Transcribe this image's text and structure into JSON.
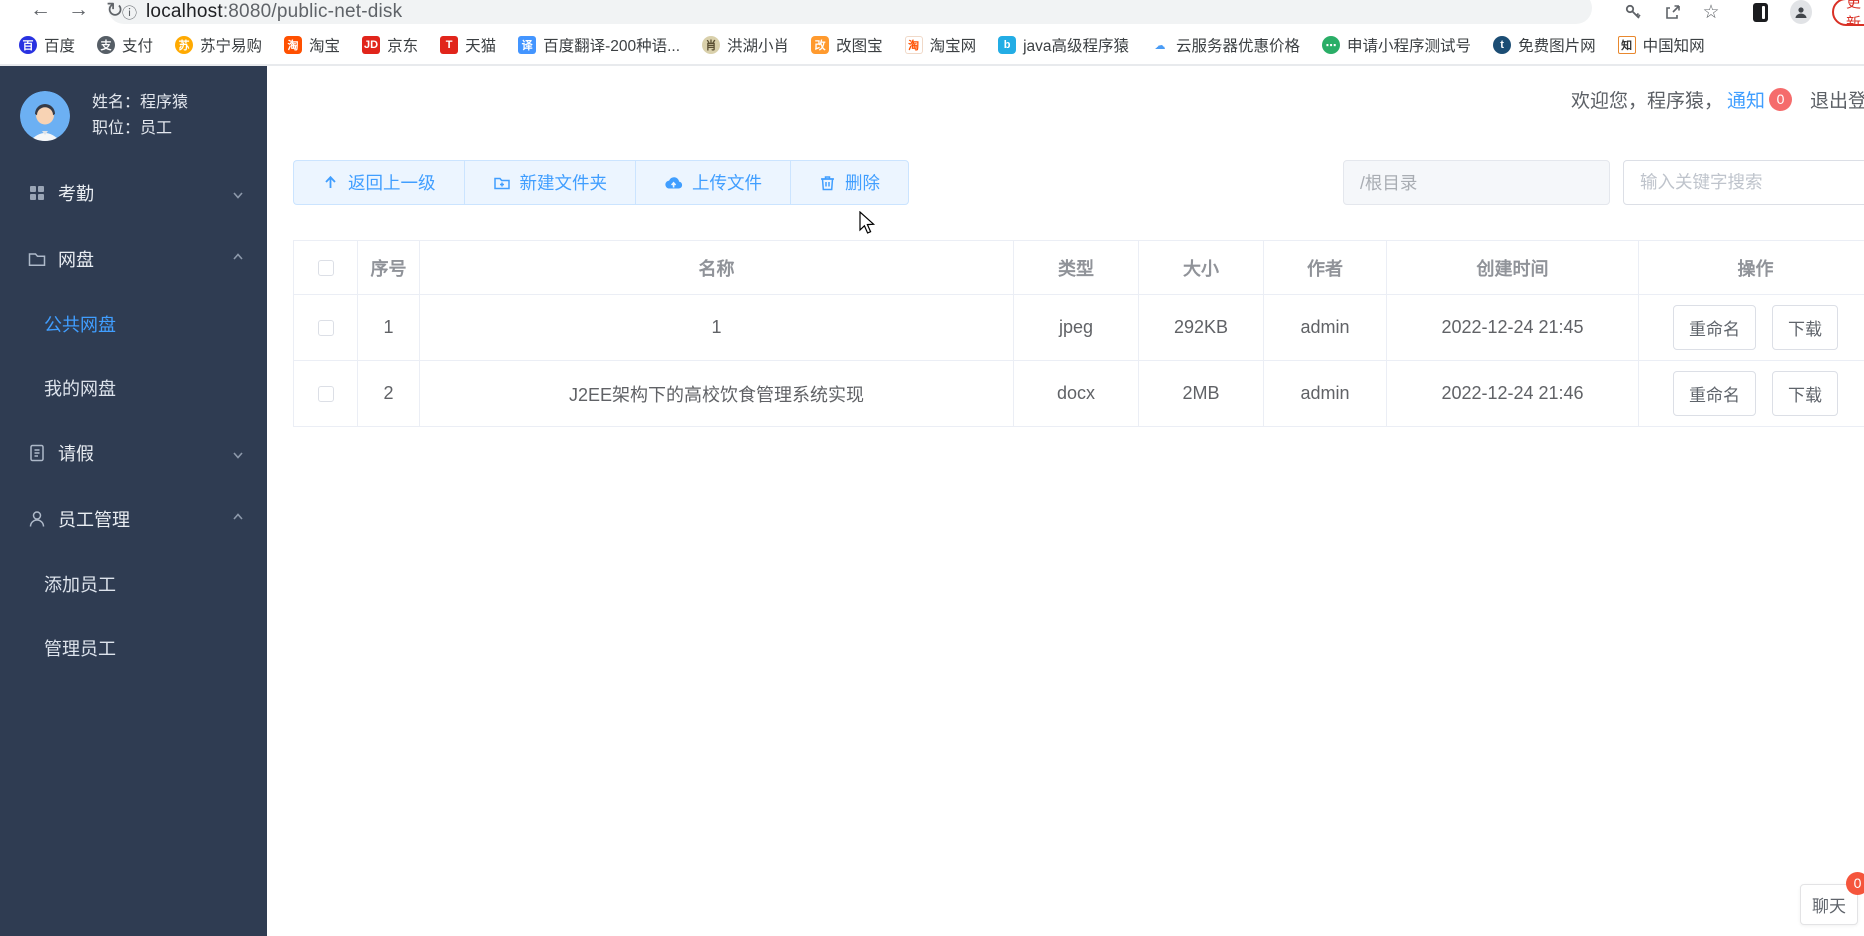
{
  "browser": {
    "url_host": "localhost",
    "url_rest": ":8080/public-net-disk",
    "update_label": "更新",
    "bookmarks": [
      {
        "label": "百度",
        "icon": {
          "glyph": "百",
          "bg": "#2932e1",
          "fg": "#ffffff",
          "radius": "50%"
        }
      },
      {
        "label": "支付",
        "icon": {
          "glyph": "支",
          "bg": "#565e66",
          "fg": "#ffffff",
          "radius": "50%"
        }
      },
      {
        "label": "苏宁易购",
        "icon": {
          "glyph": "苏",
          "bg": "#ffaa01",
          "fg": "#ffffff",
          "radius": "50%"
        }
      },
      {
        "label": "淘宝",
        "icon": {
          "glyph": "淘",
          "bg": "#ff5000",
          "fg": "#ffffff",
          "radius": "4px"
        }
      },
      {
        "label": "京东",
        "icon": {
          "glyph": "JD",
          "bg": "#e1251b",
          "fg": "#ffffff",
          "radius": "3px"
        }
      },
      {
        "label": "天猫",
        "icon": {
          "glyph": "T",
          "bg": "#e1251b",
          "fg": "#ffffff",
          "radius": "3px"
        }
      },
      {
        "label": "百度翻译-200种语...",
        "icon": {
          "glyph": "译",
          "bg": "#4395ff",
          "fg": "#ffffff",
          "radius": "3px"
        }
      },
      {
        "label": "洪湖小肖",
        "icon": {
          "glyph": "肖",
          "bg": "#d9d0ab",
          "fg": "#5a4f33",
          "radius": "50%"
        }
      },
      {
        "label": "改图宝",
        "icon": {
          "glyph": "改",
          "bg": "#ff9a2e",
          "fg": "#ffffff",
          "radius": "4px"
        }
      },
      {
        "label": "淘宝网",
        "icon": {
          "glyph": "淘",
          "bg": "#ffffff",
          "fg": "#ff5000",
          "radius": "3px",
          "border": "#f0d9c8"
        }
      },
      {
        "label": "java高级程序猿",
        "icon": {
          "glyph": "b",
          "bg": "#23ade5",
          "fg": "#ffffff",
          "radius": "4px"
        }
      },
      {
        "label": "云服务器优惠价格",
        "icon": {
          "glyph": "☁",
          "bg": "#ffffff",
          "fg": "#4a9cf5",
          "radius": "3px"
        }
      },
      {
        "label": "申请小程序测试号",
        "icon": {
          "glyph": "⋯",
          "bg": "#2aae67",
          "fg": "#ffffff",
          "radius": "50%"
        }
      },
      {
        "label": "免费图片网",
        "icon": {
          "glyph": "t",
          "bg": "#1c4d74",
          "fg": "#ffffff",
          "radius": "50%"
        }
      },
      {
        "label": "中国知网",
        "icon": {
          "glyph": "知",
          "bg": "#ffffff",
          "fg": "#333333",
          "radius": "2px",
          "border": "#e8882e"
        }
      }
    ]
  },
  "header": {
    "welcome": "欢迎您，程序猿，",
    "notice": "通知",
    "notice_count": "0",
    "logout": "退出登录"
  },
  "sidebar": {
    "user": {
      "name": "姓名：程序猿",
      "title": "职位：员工"
    },
    "menu": [
      {
        "label": "考勤",
        "icon": "grid-icon",
        "expanded": false
      },
      {
        "label": "网盘",
        "icon": "folder-icon",
        "expanded": true,
        "children": [
          {
            "label": "公共网盘",
            "active": true
          },
          {
            "label": "我的网盘",
            "active": false
          }
        ]
      },
      {
        "label": "请假",
        "icon": "document-icon",
        "expanded": false
      },
      {
        "label": "员工管理",
        "icon": "user-icon",
        "expanded": true,
        "children": [
          {
            "label": "添加员工",
            "active": false
          },
          {
            "label": "管理员工",
            "active": false
          }
        ]
      }
    ]
  },
  "toolbar": {
    "buttons": [
      {
        "label": "返回上一级",
        "icon": "arrow-up-icon"
      },
      {
        "label": "新建文件夹",
        "icon": "folder-plus-icon"
      },
      {
        "label": "上传文件",
        "icon": "cloud-upload-icon"
      },
      {
        "label": "删除",
        "icon": "trash-icon"
      }
    ],
    "path_value": "/根目录",
    "search_placeholder": "输入关键字搜索"
  },
  "table": {
    "columns": [
      "序号",
      "名称",
      "类型",
      "大小",
      "作者",
      "创建时间",
      "操作"
    ],
    "rows": [
      {
        "index": "1",
        "name": "1",
        "type": "jpeg",
        "size": "292KB",
        "author": "admin",
        "created": "2022-12-24 21:45"
      },
      {
        "index": "2",
        "name": "J2EE架构下的高校饮食管理系统实现",
        "type": "docx",
        "size": "2MB",
        "author": "admin",
        "created": "2022-12-24 21:46"
      }
    ],
    "row_actions": [
      "重命名",
      "下载"
    ]
  },
  "chat": {
    "label": "聊天",
    "badge": "0"
  },
  "colors": {
    "accent": "#409eff",
    "sidebar_bg": "#2f3c52",
    "badge_red": "#f56c6c",
    "button_bg": "#ecf5ff"
  }
}
